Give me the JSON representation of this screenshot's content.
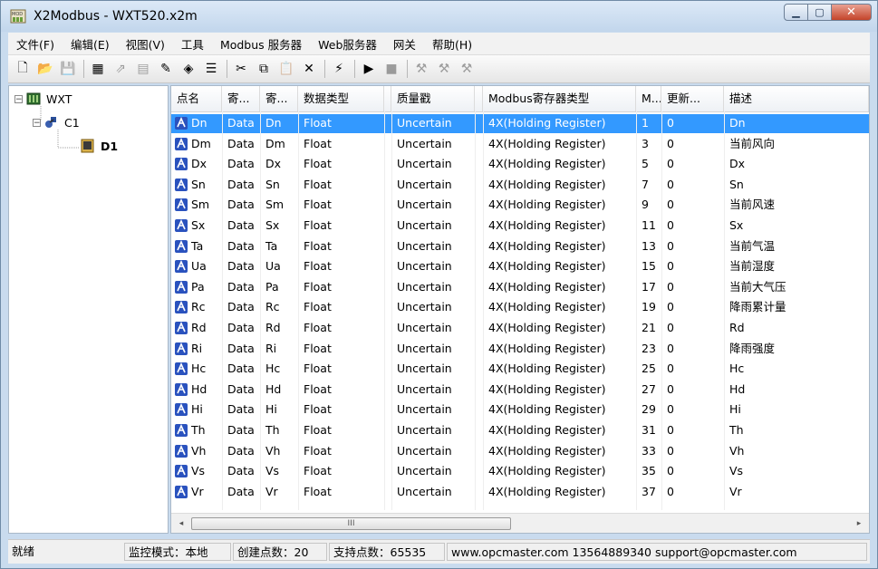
{
  "window": {
    "title": "X2Modbus - WXT520.x2m",
    "icon": "app-modbus-icon"
  },
  "menubar": [
    {
      "label": "文件(F)"
    },
    {
      "label": "编辑(E)"
    },
    {
      "label": "视图(V)"
    },
    {
      "label": "工具"
    },
    {
      "label": "Modbus 服务器"
    },
    {
      "label": "Web服务器"
    },
    {
      "label": "网关"
    },
    {
      "label": "帮助(H)"
    }
  ],
  "toolbar": {
    "icons": [
      {
        "name": "new-file-icon",
        "glyph": "🗋",
        "enabled": true
      },
      {
        "name": "open-folder-icon",
        "glyph": "📂",
        "enabled": true
      },
      {
        "name": "save-icon",
        "glyph": "💾",
        "enabled": false
      },
      {
        "name": "add-device-icon",
        "glyph": "▦",
        "enabled": true
      },
      {
        "name": "add-channel-icon",
        "glyph": "⇗",
        "enabled": false
      },
      {
        "name": "add-group-icon",
        "glyph": "▤",
        "enabled": false
      },
      {
        "name": "add-tag-icon",
        "glyph": "✎",
        "enabled": true
      },
      {
        "name": "batch-add-icon",
        "glyph": "◈",
        "enabled": true
      },
      {
        "name": "properties-icon",
        "glyph": "☰",
        "enabled": true
      },
      {
        "name": "cut-icon",
        "glyph": "✂",
        "enabled": true
      },
      {
        "name": "copy-icon",
        "glyph": "⧉",
        "enabled": true
      },
      {
        "name": "paste-icon",
        "glyph": "📋",
        "enabled": false
      },
      {
        "name": "delete-icon",
        "glyph": "✕",
        "enabled": true
      },
      {
        "name": "monitor-icon",
        "glyph": "⚡",
        "enabled": true
      },
      {
        "name": "start-icon",
        "glyph": "▶",
        "enabled": true
      },
      {
        "name": "stop-icon",
        "glyph": "■",
        "enabled": false
      },
      {
        "name": "tool-a-icon",
        "glyph": "⚒",
        "enabled": false
      },
      {
        "name": "tool-b-icon",
        "glyph": "⚒",
        "enabled": false
      },
      {
        "name": "tool-c-icon",
        "glyph": "⚒",
        "enabled": false
      }
    ]
  },
  "tree": {
    "root": {
      "label": "WXT",
      "expander": "⊟"
    },
    "channel": {
      "label": "C1",
      "expander": "⊟"
    },
    "device": {
      "label": "D1"
    }
  },
  "table": {
    "columns": [
      "点名",
      "寄...",
      "寄...",
      "数据类型",
      "质量戳",
      "Modbus寄存器类型",
      "M...",
      "更新...",
      "描述"
    ],
    "selected_row": 0,
    "rows": [
      [
        "Dn",
        "Data",
        "Dn",
        "Float",
        "Uncertain",
        "4X(Holding Register)",
        "1",
        "0",
        "Dn"
      ],
      [
        "Dm",
        "Data",
        "Dm",
        "Float",
        "Uncertain",
        "4X(Holding Register)",
        "3",
        "0",
        "当前风向"
      ],
      [
        "Dx",
        "Data",
        "Dx",
        "Float",
        "Uncertain",
        "4X(Holding Register)",
        "5",
        "0",
        "Dx"
      ],
      [
        "Sn",
        "Data",
        "Sn",
        "Float",
        "Uncertain",
        "4X(Holding Register)",
        "7",
        "0",
        "Sn"
      ],
      [
        "Sm",
        "Data",
        "Sm",
        "Float",
        "Uncertain",
        "4X(Holding Register)",
        "9",
        "0",
        "当前风速"
      ],
      [
        "Sx",
        "Data",
        "Sx",
        "Float",
        "Uncertain",
        "4X(Holding Register)",
        "11",
        "0",
        "Sx"
      ],
      [
        "Ta",
        "Data",
        "Ta",
        "Float",
        "Uncertain",
        "4X(Holding Register)",
        "13",
        "0",
        "当前气温"
      ],
      [
        "Ua",
        "Data",
        "Ua",
        "Float",
        "Uncertain",
        "4X(Holding Register)",
        "15",
        "0",
        "当前湿度"
      ],
      [
        "Pa",
        "Data",
        "Pa",
        "Float",
        "Uncertain",
        "4X(Holding Register)",
        "17",
        "0",
        "当前大气压"
      ],
      [
        "Rc",
        "Data",
        "Rc",
        "Float",
        "Uncertain",
        "4X(Holding Register)",
        "19",
        "0",
        "降雨累计量"
      ],
      [
        "Rd",
        "Data",
        "Rd",
        "Float",
        "Uncertain",
        "4X(Holding Register)",
        "21",
        "0",
        "Rd"
      ],
      [
        "Ri",
        "Data",
        "Ri",
        "Float",
        "Uncertain",
        "4X(Holding Register)",
        "23",
        "0",
        "降雨强度"
      ],
      [
        "Hc",
        "Data",
        "Hc",
        "Float",
        "Uncertain",
        "4X(Holding Register)",
        "25",
        "0",
        "Hc"
      ],
      [
        "Hd",
        "Data",
        "Hd",
        "Float",
        "Uncertain",
        "4X(Holding Register)",
        "27",
        "0",
        "Hd"
      ],
      [
        "Hi",
        "Data",
        "Hi",
        "Float",
        "Uncertain",
        "4X(Holding Register)",
        "29",
        "0",
        "Hi"
      ],
      [
        "Th",
        "Data",
        "Th",
        "Float",
        "Uncertain",
        "4X(Holding Register)",
        "31",
        "0",
        "Th"
      ],
      [
        "Vh",
        "Data",
        "Vh",
        "Float",
        "Uncertain",
        "4X(Holding Register)",
        "33",
        "0",
        "Vh"
      ],
      [
        "Vs",
        "Data",
        "Vs",
        "Float",
        "Uncertain",
        "4X(Holding Register)",
        "35",
        "0",
        "Vs"
      ],
      [
        "Vr",
        "Data",
        "Vr",
        "Float",
        "Uncertain",
        "4X(Holding Register)",
        "37",
        "0",
        "Vr"
      ]
    ]
  },
  "scrollbar": {
    "left_arrow": "◂",
    "right_arrow": "▸",
    "grip": "III"
  },
  "statusbar": [
    "就绪",
    "监控模式：本地",
    "创建点数：20",
    "支持点数：65535",
    "www.opcmaster.com 13564889340 support@opcmaster.com"
  ],
  "colors": {
    "selection": "#3399ff",
    "tag_icon": "#2a52be"
  }
}
